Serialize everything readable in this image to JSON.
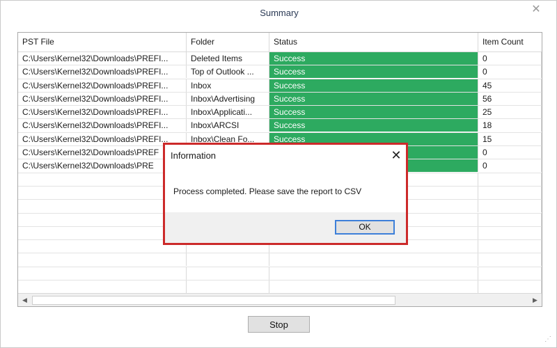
{
  "window": {
    "title": "Summary",
    "close_glyph": "✕"
  },
  "grid": {
    "columns": [
      "PST File",
      "Folder",
      "Status",
      "Item Count"
    ],
    "rows": [
      {
        "file": "C:\\Users\\Kernel32\\Downloads\\PREFI...",
        "folder": "Deleted Items",
        "status": "Success",
        "count": "0"
      },
      {
        "file": "C:\\Users\\Kernel32\\Downloads\\PREFI...",
        "folder": "Top of Outlook ...",
        "status": "Success",
        "count": "0"
      },
      {
        "file": "C:\\Users\\Kernel32\\Downloads\\PREFI...",
        "folder": "Inbox",
        "status": "Success",
        "count": "45"
      },
      {
        "file": "C:\\Users\\Kernel32\\Downloads\\PREFI...",
        "folder": "Inbox\\Advertising",
        "status": "Success",
        "count": "56"
      },
      {
        "file": "C:\\Users\\Kernel32\\Downloads\\PREFI...",
        "folder": "Inbox\\Applicati...",
        "status": "Success",
        "count": "25"
      },
      {
        "file": "C:\\Users\\Kernel32\\Downloads\\PREFI...",
        "folder": "Inbox\\ARCSI",
        "status": "Success",
        "count": "18"
      },
      {
        "file": "C:\\Users\\Kernel32\\Downloads\\PREFI...",
        "folder": "Inbox\\Clean Fo...",
        "status": "Success",
        "count": "15"
      },
      {
        "file": "C:\\Users\\Kernel32\\Downloads\\PREF",
        "folder": "",
        "status": "",
        "count": "0"
      },
      {
        "file": "C:\\Users\\Kernel32\\Downloads\\PRE",
        "folder": "",
        "status": "",
        "count": "0"
      }
    ],
    "status_color": "#2daa60"
  },
  "stop_label": "Stop",
  "dialog": {
    "title": "Information",
    "message": "Process completed. Please save the report to CSV",
    "ok_label": "OK",
    "close_glyph": "✕",
    "highlight_color": "#cc2a2a"
  },
  "scrollbar": {
    "left_arrow": "◀",
    "right_arrow": "▶"
  }
}
